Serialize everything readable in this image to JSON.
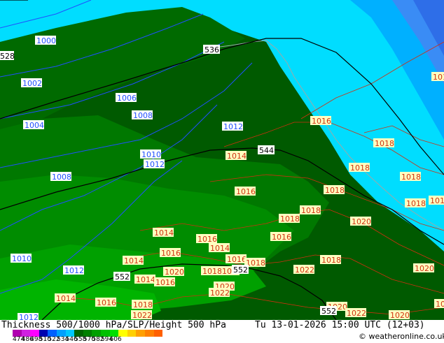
{
  "title": "Thickness 500/1000 hPa/SLP/Height 500 hPa",
  "valid_time": "Tu 13-01-2026 15:00 UTC (12+03)",
  "credit": "© weatheronline.co.uk",
  "legend": {
    "values": [
      "474",
      "486",
      "498",
      "510",
      "522",
      "534",
      "546",
      "558",
      "570",
      "582",
      "594",
      "606"
    ],
    "colors": [
      "#b000b0",
      "#d020e0",
      "#ff00ff",
      "#0000b0",
      "#0060ff",
      "#00a0ff",
      "#00c8ff",
      "#006400",
      "#008000",
      "#00a000",
      "#00c000",
      "#00e000",
      "#ffff00",
      "#ffd000",
      "#ffa000",
      "#ff8000",
      "#ff6000"
    ]
  },
  "colors": {
    "ocean_light": "#00ddff",
    "ocean_mid": "#00b0ff",
    "ocean_deep": "#3a8cf5",
    "green_dark": "#005a00",
    "green_mid": "#007800",
    "green_light": "#009a00",
    "green_lighter": "#00b400",
    "slp_contour": "#d03010",
    "slp_blue": "#2050ff",
    "height_line": "#000000"
  },
  "slp_labels_blue": [
    "1000",
    "1002",
    "1004",
    "1006",
    "1008",
    "1008",
    "1010",
    "1012",
    "1012",
    "1012",
    "1012",
    "1012",
    "1010",
    "1012"
  ],
  "slp_labels_red": [
    "1016",
    "1018",
    "1018",
    "1018",
    "1018",
    "1018",
    "1014",
    "1016",
    "1018",
    "1014",
    "1016",
    "1014",
    "1016",
    "1018",
    "1018",
    "1016",
    "1020",
    "1022",
    "1020",
    "1014",
    "1016",
    "1014",
    "1016",
    "1020",
    "1018",
    "1016",
    "1018",
    "1020",
    "1022",
    "1020",
    "1022",
    "1020",
    "1022",
    "1018",
    "1016",
    "1014",
    "1016",
    "1016",
    "1020"
  ],
  "height_labels": [
    "528",
    "536",
    "544",
    "552",
    "552",
    "552"
  ]
}
